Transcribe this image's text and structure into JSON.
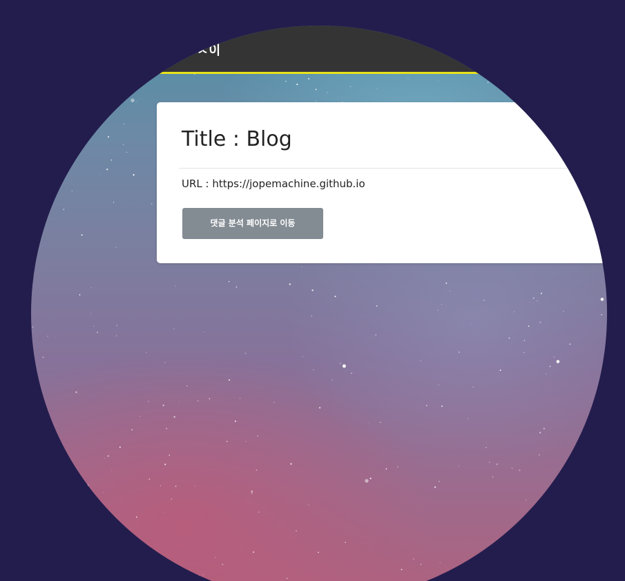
{
  "topbar": {
    "title": "ㅅ이"
  },
  "card": {
    "title": "Title : Blog",
    "url": "URL : https://jopemachine.github.io",
    "button_label": "댓글 분석 페이지로 이동"
  },
  "colors": {
    "page_background": "#231d4d",
    "topbar_background": "#343435",
    "topbar_accent": "#e8e21a",
    "card_background": "#ffffff",
    "button_background": "#838b93"
  },
  "icons": {
    "background": "starry-sky-image"
  }
}
